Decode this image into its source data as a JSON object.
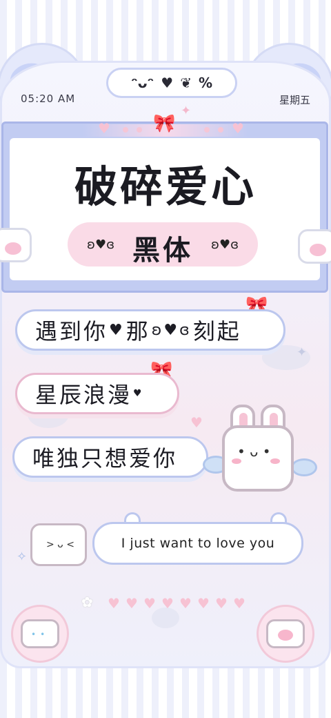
{
  "status": {
    "time": "05:20 AM",
    "weekday": "星期五"
  },
  "top_pill": {
    "icons": [
      "smile-face-icon",
      "broken-heart-icon",
      "hearts-icon",
      "percent-icon"
    ]
  },
  "title": {
    "main": "破碎爱心",
    "sub": "黑体"
  },
  "phrases": [
    {
      "before": "遇到你",
      "after_heart": "那",
      "after_wing": "刻起"
    },
    {
      "text": "星辰浪漫"
    },
    {
      "text": "唯独只想爱你"
    }
  ],
  "bubble": {
    "text": "I just want to love you"
  },
  "colors": {
    "accent_blue": "#c2ccf2",
    "accent_pink": "#fadbe7",
    "text": "#1b1b22"
  }
}
